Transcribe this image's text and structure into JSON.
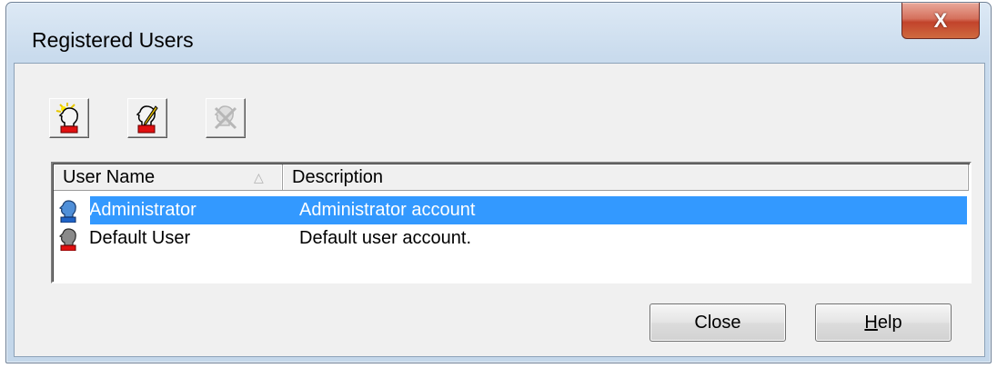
{
  "window": {
    "title": "Registered Users",
    "close_glyph": "X"
  },
  "toolbar": {
    "buttons": [
      {
        "icon": "add-user-icon",
        "enabled": true
      },
      {
        "icon": "edit-user-icon",
        "enabled": true
      },
      {
        "icon": "delete-user-icon",
        "enabled": false
      }
    ]
  },
  "list": {
    "columns": [
      "User Name",
      "Description"
    ],
    "sort_indicator": "△",
    "rows": [
      {
        "name": "Administrator",
        "description": "Administrator account",
        "selected": true,
        "icon": "user-blue-icon"
      },
      {
        "name": "Default User",
        "description": "Default user account.",
        "selected": false,
        "icon": "user-gray-icon"
      }
    ]
  },
  "buttons": {
    "close": "Close",
    "help": "Help"
  },
  "colors": {
    "selection": "#3399ff",
    "titlebar_close": "#c2432b"
  }
}
